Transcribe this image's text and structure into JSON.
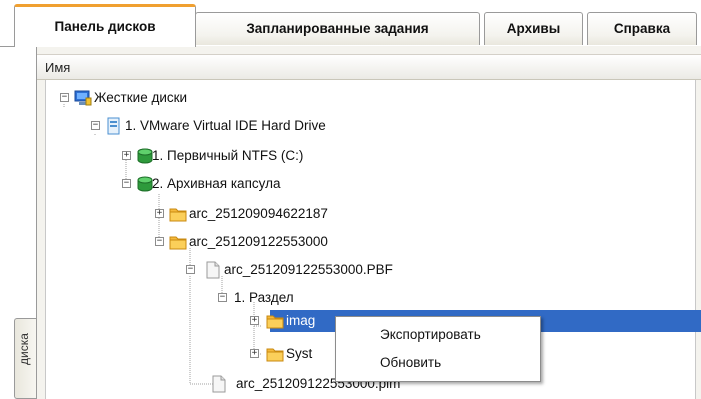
{
  "tabs": [
    {
      "label": "Панель дисков",
      "active": true
    },
    {
      "label": "Запланированные задания",
      "active": false
    },
    {
      "label": "Архивы",
      "active": false
    },
    {
      "label": "Справка",
      "active": false
    }
  ],
  "side_tab": {
    "label": "диска"
  },
  "column_header": {
    "label": "Имя"
  },
  "tree": {
    "hard_disks": {
      "label": "Жесткие диски",
      "icon": "computer-icon"
    },
    "drive1": {
      "label": "1. VMware Virtual IDE Hard Drive",
      "icon": "hard-drive-icon"
    },
    "partition_ntfs": {
      "label": "1. Первичный NTFS (C:)",
      "icon": "partition-icon"
    },
    "archive_capsule": {
      "label": "2. Архивная капсула",
      "icon": "partition-icon"
    },
    "arc1": {
      "label": "arc_251209094622187",
      "icon": "folder-icon"
    },
    "arc2": {
      "label": "arc_251209122553000",
      "icon": "folder-icon"
    },
    "pbf_file": {
      "label": "arc_251209122553000.PBF",
      "icon": "file-icon"
    },
    "section1": {
      "label": "1. Раздел"
    },
    "images": {
      "label": "imag",
      "icon": "folder-icon"
    },
    "system": {
      "label": "Syst",
      "icon": "folder-icon"
    },
    "pim_file": {
      "label": "arc_251209122553000.pim",
      "icon": "file-icon"
    }
  },
  "context_menu": {
    "export": "Экспортировать",
    "refresh": "Обновить"
  },
  "colors": {
    "selection": "#316ac5",
    "active_tab_accent": "#f0a030",
    "folder": "#f5b93c",
    "partition": "#2e9a3c"
  }
}
